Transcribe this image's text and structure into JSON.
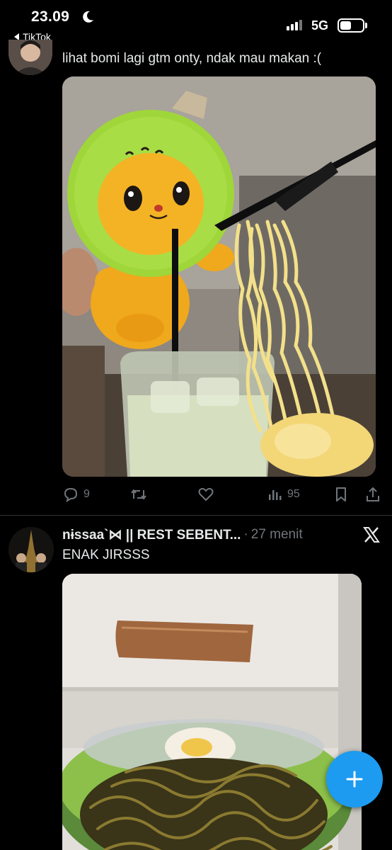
{
  "status_bar": {
    "time": "23.09",
    "back_app": "TikTok",
    "network": "5G"
  },
  "tweet1": {
    "text": "lihat bomi lagi gtm onty, ndak mau makan :(",
    "media_icon": "photo-image",
    "actions": {
      "replies": "9",
      "retweets": "",
      "likes": "",
      "views": "95"
    }
  },
  "tweet2": {
    "display_name": "nɨssaa`⋈ || REST SEBENT...",
    "separator": "·",
    "time": "27 menit",
    "text": "ENAK JIRSSS",
    "media_icon": "photo-image"
  },
  "colors": {
    "background": "#000000",
    "text": "#e7e9ea",
    "muted": "#71767b",
    "accent": "#1d9bf0"
  }
}
